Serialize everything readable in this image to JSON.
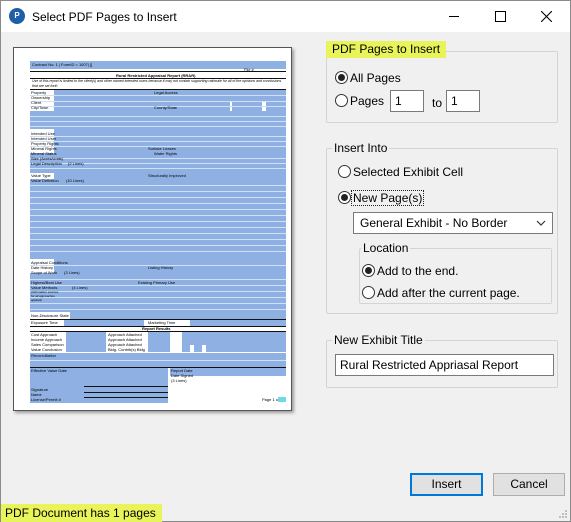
{
  "window": {
    "title": "Select PDF Pages to Insert",
    "app_icon_text": "P"
  },
  "preview": {
    "header_text": "Contract No: 1 | FormID = 1007| []",
    "file_label": "File #",
    "report_title": "Rural Restricted Appraisal Report (RRAR)",
    "intro_text": "Use of this report is limited to the client(s) and other named intended users because it may not contain supporting rationale for all of the opinions and conclusions that are set forth",
    "labels": {
      "property": "Property",
      "ownership": "Ownership",
      "client": "Client",
      "city_town": "City/Town",
      "legal_access": "Legal Access",
      "county_state": "County/State",
      "intended_use": "Intended Use",
      "intended_user": "Intended User",
      "property_rights": "Property Rights",
      "mineral_rights": "Mineral Rights",
      "mineral_status": "Mineral Status",
      "size": "Size (Acres/Units)",
      "legal_description": "Legal Description",
      "surface_leases": "Surface Leases",
      "water_rights": "Water Rights",
      "value_type": "Value Type",
      "value_definition": "Value Definition",
      "structurally_improved": "Structurally Improved",
      "appraisal_conditions": "Appraisal Conditions",
      "date_history": "Date History",
      "scope_of_work": "Scope of Work",
      "listing_history": "Listing History",
      "highest_best_use": "Highest/Best Use",
      "value_methods": "Value Methods",
      "existing_primary_use": "Existing Primary Use",
      "value_methods_note": "(Information sources for all approaches applied)",
      "non_disclosure": "Non-Disclosure State",
      "exposure_time": "Exposure Time",
      "marketing_time": "Marketing Time",
      "report_results": "Report Results",
      "cost_approach": "Cost Approach",
      "income_approach": "Income Approach",
      "sales_comparison": "Sales Comparison",
      "value_conclusion": "Value Conclusion",
      "approach_attached_1": "Approach Attached",
      "approach_attached_2": "Approach Attached",
      "approach_attached_3": "Approach Attached",
      "bldg_contrib": "Bldg. Contrib(s) Bldg",
      "reconciliation": "Reconciliation",
      "effective_value_date": "Effective Value Date",
      "report_date": "Report Date",
      "date_signed": "Date Signed",
      "signature": "Signature",
      "name": "Name",
      "license": "License/Permit #",
      "lines_2": "(2 Lines)",
      "lines_10": "(10 Lines)",
      "lines_3": "(3 Lines)",
      "lines_4": "(4 Lines)",
      "page_of": "Page 1 of"
    }
  },
  "pdf_pages": {
    "legend": "PDF Pages to Insert",
    "all_pages_label": "All Pages",
    "pages_label": "Pages",
    "from_value": "1",
    "to_label": "to",
    "to_value": "1"
  },
  "insert_into": {
    "legend": "Insert Into",
    "selected_cell_label": "Selected Exhibit Cell",
    "new_pages_label": "New Page(s)",
    "exhibit_type": "General Exhibit - No Border",
    "location": {
      "legend": "Location",
      "add_to_end_label": "Add to the end.",
      "add_after_label": "Add after the current page."
    }
  },
  "exhibit_title": {
    "legend": "New Exhibit Title",
    "value": "Rural Restricted Appriasal Report"
  },
  "buttons": {
    "insert": "Insert",
    "cancel": "Cancel"
  },
  "status": {
    "text": "PDF Document has 1 pages"
  },
  "colors": {
    "highlight": "#e8f45a",
    "preview_fill": "#8fb0e2",
    "focus_border": "#0078d7"
  }
}
